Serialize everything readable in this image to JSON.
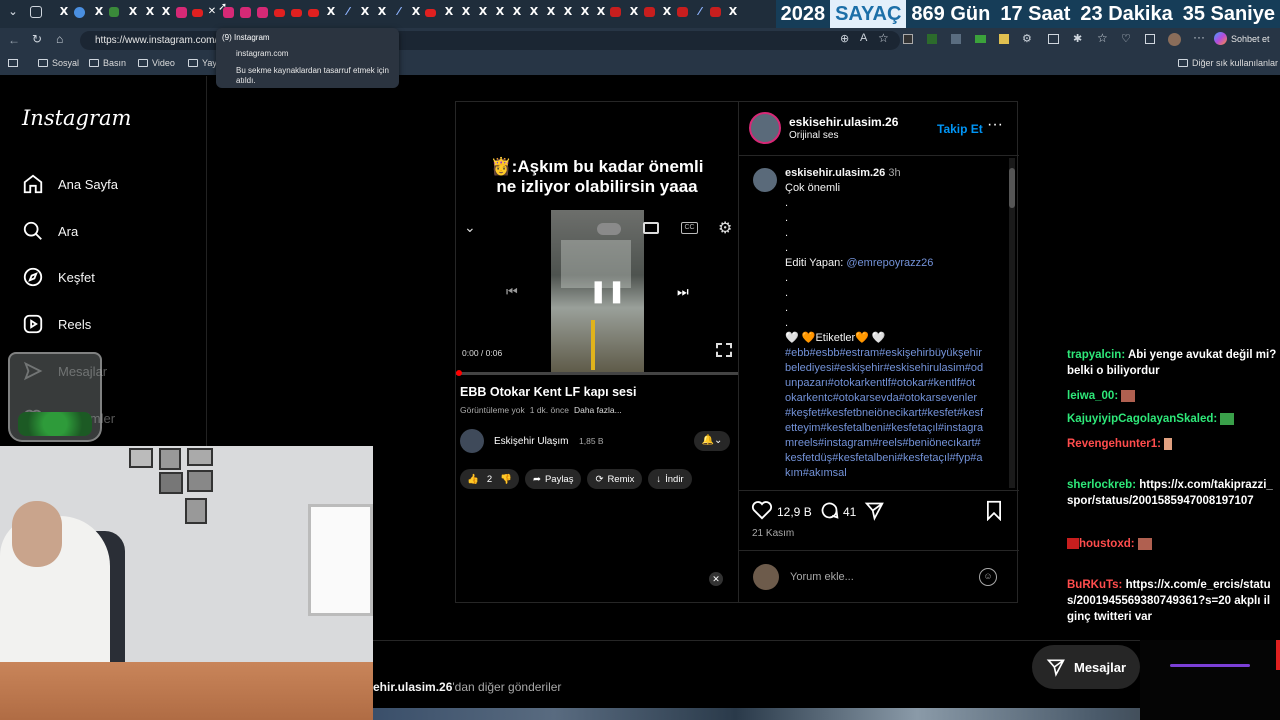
{
  "browser": {
    "url": "https://www.instagram.com/p",
    "profile_label": "Sohbet et",
    "bookmarks": [
      "Sosyal",
      "Basın",
      "Video",
      "Yay"
    ],
    "other_bookmarks": "Diğer sık kullanılanlar",
    "tab_tooltip": {
      "title": "(9) Instagram",
      "domain": "instagram.com",
      "note": "Bu sekme kaynaklardan tasarruf etmek için atıldı."
    }
  },
  "counter": {
    "year": "2028",
    "label": "SAYAÇ",
    "days": "869 Gün",
    "hours": "17 Saat",
    "minutes": "23 Dakika",
    "seconds": "35 Saniye"
  },
  "instagram": {
    "logo": "Instagram",
    "nav": [
      "Ana Sayfa",
      "Ara",
      "Keşfet",
      "Reels",
      "Mesajlar",
      "Bildirimler"
    ],
    "post": {
      "username": "eskisehir.ulasim.26",
      "audio": "Orijinal ses",
      "follow_label": "Takip Et",
      "caption_user": "eskisehir.ulasim.26",
      "caption_time": "3h",
      "caption_title": "Çok önemli",
      "dot": ".",
      "editor_prefix": "Editi Yapan:",
      "editor_handle": "@emrepoyrazz26",
      "tags_heading": "🤍 🧡Etiketler🧡 🤍",
      "tags_line1": "#ebb#esbb#estram#eskişehirbüyükşehir",
      "tags_line2": "belediyesi#eskişehir#eskisehirulasim#od",
      "tags_line3": "unpazarı#otokarkentlf#otokar#kentlf#ot",
      "tags_line4": "okarkentc#otokarsevda#otokarsevenler",
      "tags_line5": "#keşfet#kesfetbneiönecikart#kesfet#kesf",
      "tags_line6": "etteyim#kesfetalbeni#kesfetaçıl#instagra",
      "tags_line7": "mreels#instagram#reels#beniönecıkart#",
      "tags_line8": "kesfetdüş#kesfetalbeni#kesfetaçıl#fyp#a",
      "tags_line9": "kım#akımsal",
      "likes": "12,9 B",
      "comments": "41",
      "date": "21 Kasım",
      "comment_placeholder": "Yorum ekle..."
    },
    "more_posts_prefix": "ehir.ulasim.26",
    "more_posts_suffix": "'dan diğer gönderiler",
    "messages_label": "Mesajlar"
  },
  "video": {
    "overlay_line1": "👸:Aşkım bu kadar önemli",
    "overlay_line2": "ne izliyor olabilirsin yaaa",
    "time": "0:00 / 0:06",
    "title": "EBB Otokar Kent LF kapı sesi",
    "views": "Görüntüleme yok",
    "ago": "1 dk. önce",
    "more": "Daha fazla...",
    "channel": "Eskişehir Ulaşım",
    "subs": "1,85 B",
    "like_count": "2",
    "share": "Paylaş",
    "remix": "Remix",
    "download": "İndir"
  },
  "chat": [
    {
      "user": "trapyalcin:",
      "text": "Abi yenge avukat değil mi? belki o biliyordur"
    },
    {
      "user": "leiwa_00:",
      "text": ""
    },
    {
      "user": "KajuyiyipCagolayanSkaled:",
      "text": ""
    },
    {
      "user": "Revengehunter1:",
      "text": ""
    },
    {
      "user": "sherlockreb:",
      "text": "https://x.com/takiprazzi_spor/status/2001585947008197107"
    },
    {
      "user": "houstoxd:",
      "text": ""
    },
    {
      "user": "BuRKuTs:",
      "text": "https://x.com/e_ercis/status/2001945569380749361?s=20 akplı ilginç twitteri var"
    }
  ],
  "colors": {
    "chat_user": "#2ee879",
    "red_user": "#ff4d4d",
    "link": "#7392d8",
    "accent": "#0095f6"
  }
}
